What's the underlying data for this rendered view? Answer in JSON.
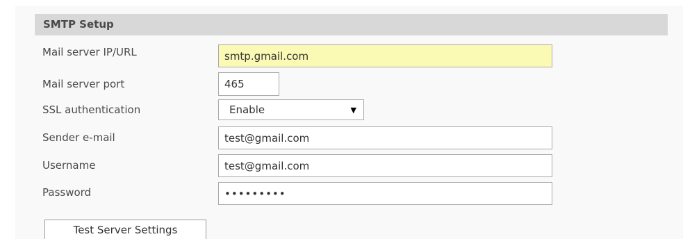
{
  "section": {
    "title": "SMTP Setup"
  },
  "form": {
    "mail_server": {
      "label": "Mail server IP/URL",
      "value": "smtp.gmail.com"
    },
    "port": {
      "label": "Mail server port",
      "value": "465"
    },
    "ssl": {
      "label": "SSL authentication",
      "selected": "Enable"
    },
    "sender": {
      "label": "Sender e-mail",
      "value": "test@gmail.com"
    },
    "username": {
      "label": "Username",
      "value": "test@gmail.com"
    },
    "password": {
      "label": "Password",
      "value": "•••••••••"
    }
  },
  "actions": {
    "test_label": "Test Server Settings"
  },
  "colors": {
    "header_bg": "#d8d8d8",
    "highlight_field": "#fafab5",
    "label_text": "#4a4a4a"
  }
}
